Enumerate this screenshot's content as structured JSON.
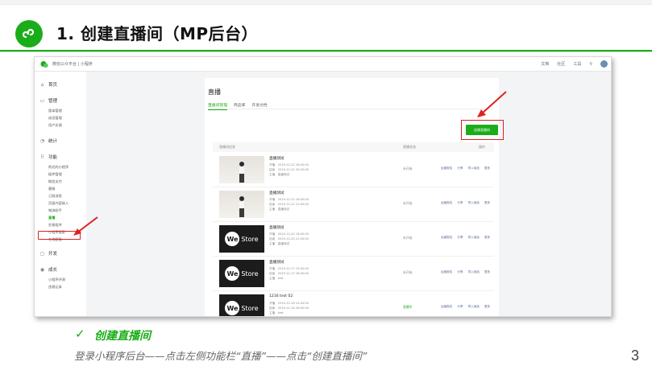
{
  "slide": {
    "title": "1. 创建直播间（MP后台）",
    "check_mark": "✓",
    "step_title": "创建直播间",
    "step_desc": "登录小程序后台——点击左侧功能栏“直播”——点击“创建直播间”",
    "page_number": "3"
  },
  "colors": {
    "brand_green": "#1aad19",
    "highlight_red": "#e02020",
    "link_blue": "#576b95"
  },
  "screenshot": {
    "brand": "微信公众平台 | 小程序",
    "top_links": [
      "文档",
      "社区",
      "工具",
      "⚲"
    ],
    "sidebar": {
      "groups": [
        {
          "icon": "home-icon",
          "glyph": "⌂",
          "label": "首页",
          "items": []
        },
        {
          "icon": "manage-icon",
          "glyph": "▭",
          "label": "管理",
          "items": [
            "版本管理",
            "成员管理",
            "用户反馈"
          ]
        },
        {
          "icon": "stats-icon",
          "glyph": "◔",
          "label": "统计",
          "items": []
        },
        {
          "icon": "features-icon",
          "glyph": "⠿",
          "label": "功能",
          "items": [
            "附近的小程序",
            "插件管理",
            "微信支付",
            "客服",
            "订阅消息",
            "页面内容接入",
            "物流助手",
            "直播",
            "交易组件",
            "小程序搜索",
            "在线客服"
          ]
        },
        {
          "icon": "dev-icon",
          "glyph": "▢",
          "label": "开发",
          "items": []
        },
        {
          "icon": "growth-icon",
          "glyph": "◉",
          "label": "成长",
          "items": [
            "小程序评测",
            "违规记录"
          ]
        }
      ],
      "active_item": "直播"
    },
    "main": {
      "title": "直播",
      "tabs": [
        "直播间管理",
        "商品库",
        "开发文档"
      ],
      "create_button": "创建直播间",
      "columns": [
        "直播间信息",
        "直播状态",
        "操作"
      ],
      "rows": [
        {
          "cover": "photo",
          "name": "直播测试",
          "start": "开播　2019-12-22 18:00:00",
          "end": "结束　2019-12-22 20:00:00",
          "host": "主播　直播测试",
          "status": "未开始",
          "live": false,
          "actions": [
            "运营报告",
            "分享",
            "导入商品",
            "更多"
          ]
        },
        {
          "cover": "photo",
          "name": "直播测试",
          "start": "开播　2019-12-21 18:00:00",
          "end": "结束　2019-12-21 21:00:00",
          "host": "主播　直播测试",
          "status": "未开始",
          "live": false,
          "actions": [
            "运营报告",
            "分享",
            "导入商品",
            "更多"
          ]
        },
        {
          "cover": "westore",
          "name": "直播测试",
          "start": "开播　2019-12-20 18:00:00",
          "end": "结束　2019-12-20 21:00:00",
          "host": "主播　直播测试",
          "status": "未开始",
          "live": false,
          "actions": [
            "运营报告",
            "分享",
            "导入商品",
            "更多"
          ]
        },
        {
          "cover": "westore",
          "name": "直播测试",
          "start": "开播　2019-12-17 15:00:00",
          "end": "结束　2019-12-17 18:00:00",
          "host": "主播　test",
          "status": "未开始",
          "live": false,
          "actions": [
            "运营报告",
            "分享",
            "导入商品",
            "更多"
          ]
        },
        {
          "cover": "westore",
          "name": "1216 test 02",
          "start": "开播　2019-12-16 14:45:00",
          "end": "结束　2019-12-16 18:00:00",
          "host": "主播　test",
          "status": "直播中",
          "live": true,
          "actions": [
            "运营报告",
            "分享",
            "导入商品",
            "更多"
          ]
        }
      ],
      "cover_text": {
        "we": "We",
        "store": "Store"
      }
    }
  }
}
